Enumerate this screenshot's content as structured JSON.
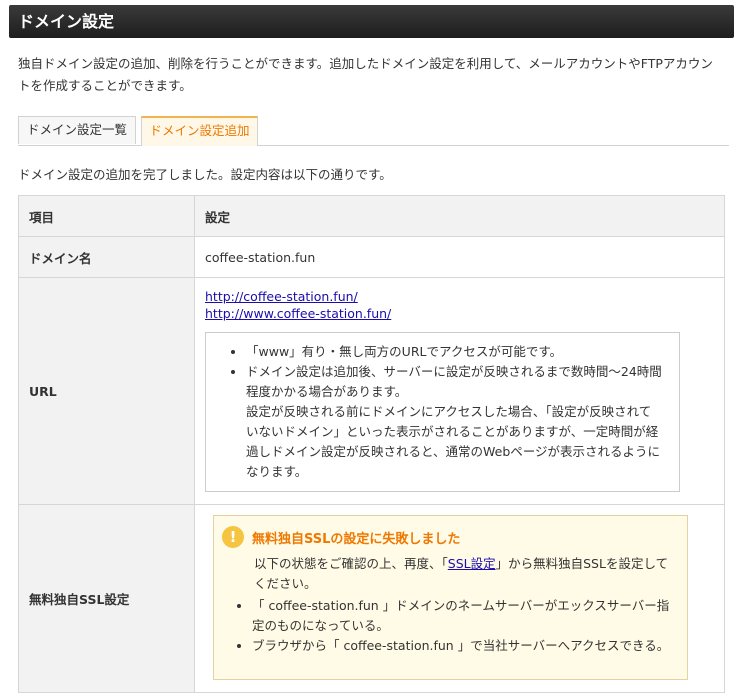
{
  "header": {
    "title": "ドメイン設定"
  },
  "intro": "独自ドメイン設定の追加、削除を行うことができます。追加したドメイン設定を利用して、メールアカウントやFTPアカウントを作成することができます。",
  "tabs": [
    {
      "label": "ドメイン設定一覧",
      "active": false
    },
    {
      "label": "ドメイン設定追加",
      "active": true
    }
  ],
  "complete_message": "ドメイン設定の追加を完了しました。設定内容は以下の通りです。",
  "table": {
    "col_item": "項目",
    "col_setting": "設定",
    "domain_label": "ドメイン名",
    "domain_value": "coffee-station.fun",
    "url_label": "URL",
    "urls": [
      "http://coffee-station.fun/",
      "http://www.coffee-station.fun/"
    ],
    "url_notes": [
      "「www」有り・無し両方のURLでアクセスが可能です。",
      "ドメイン設定は追加後、サーバーに設定が反映されるまで数時間～24時間程度かかる場合があります。"
    ],
    "url_note_extra": "設定が反映される前にドメインにアクセスした場合、「設定が反映されていないドメイン」といった表示がされることがありますが、一定時間が経過しドメイン設定が反映されると、通常のWebページが表示されるようになります。",
    "ssl_label": "無料独自SSL設定",
    "ssl_error_title": "無料独自SSLの設定に失敗しました",
    "ssl_text_before": "以下の状態をご確認の上、再度、「",
    "ssl_link": "SSL設定",
    "ssl_text_after": "」から無料独自SSLを設定してください。",
    "ssl_items": [
      "「 coffee-station.fun 」ドメインのネームサーバーがエックスサーバー指定のものになっている。",
      "ブラウザから「 coffee-station.fun 」で当社サーバーへアクセスできる。"
    ]
  },
  "colors": {
    "accent": "#ee7800",
    "warning_bg": "#fffbe6",
    "header_bg": "#2b2b2b"
  }
}
